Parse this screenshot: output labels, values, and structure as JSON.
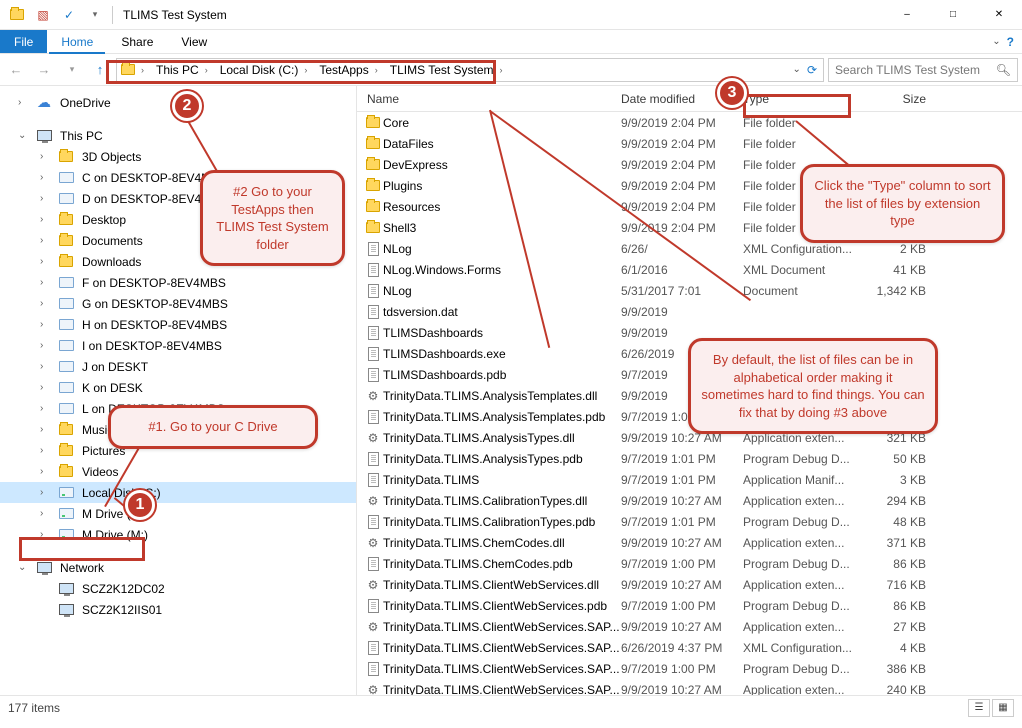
{
  "window": {
    "title": "TLIMS Test System"
  },
  "ribbon": {
    "file": "File",
    "tabs": [
      "Home",
      "Share",
      "View"
    ]
  },
  "breadcrumb": [
    "This PC",
    "Local Disk (C:)",
    "TestApps",
    "TLIMS Test System"
  ],
  "search": {
    "placeholder": "Search TLIMS Test System"
  },
  "columns": {
    "name": "Name",
    "date": "Date modified",
    "type": "Type",
    "size": "Size"
  },
  "tree": {
    "onedrive": "OneDrive",
    "thispc": "This PC",
    "pcitems": [
      "3D Objects",
      "C on DESKTOP-8EV4MBS",
      "D on DESKTOP-8EV4MBS",
      "Desktop",
      "Documents",
      "Downloads",
      "F on DESKTOP-8EV4MBS",
      "G on DESKTOP-8EV4MBS",
      "H on DESKTOP-8EV4MBS",
      "I on DESKTOP-8EV4MBS",
      "J on DESKT",
      "K on DESK",
      "L on DESKTOP-8EV4MBS",
      "Music",
      "Pictures",
      "Videos",
      "Local Disk (C:)",
      "M Drive (M:)",
      "M Drive (M:)"
    ],
    "network": "Network",
    "netitems": [
      "SCZ2K12DC02",
      "SCZ2K12IIS01"
    ]
  },
  "files": [
    {
      "icon": "folder",
      "name": "Core",
      "date": "9/9/2019 2:04 PM",
      "type": "File folder",
      "size": ""
    },
    {
      "icon": "folder",
      "name": "DataFiles",
      "date": "9/9/2019 2:04 PM",
      "type": "File folder",
      "size": ""
    },
    {
      "icon": "folder",
      "name": "DevExpress",
      "date": "9/9/2019 2:04 PM",
      "type": "File folder",
      "size": ""
    },
    {
      "icon": "folder",
      "name": "Plugins",
      "date": "9/9/2019 2:04 PM",
      "type": "File folder",
      "size": ""
    },
    {
      "icon": "folder",
      "name": "Resources",
      "date": "9/9/2019 2:04 PM",
      "type": "File folder",
      "size": ""
    },
    {
      "icon": "folder",
      "name": "Shell3",
      "date": "9/9/2019 2:04 PM",
      "type": "File folder",
      "size": ""
    },
    {
      "icon": "file",
      "name": "NLog",
      "date": "6/26/",
      "type": "XML Configuration...",
      "size": "2 KB"
    },
    {
      "icon": "file",
      "name": "NLog.Windows.Forms",
      "date": "6/1/2016 ",
      "type": "XML Document",
      "size": "41 KB"
    },
    {
      "icon": "file",
      "name": "NLog",
      "date": "5/31/2017 7:01",
      "type": "Document",
      "size": "1,342 KB"
    },
    {
      "icon": "file",
      "name": "tdsversion.dat",
      "date": "9/9/2019",
      "type": "",
      "size": ""
    },
    {
      "icon": "file",
      "name": "TLIMSDashboards",
      "date": "9/9/2019",
      "type": "",
      "size": ""
    },
    {
      "icon": "file",
      "name": "TLIMSDashboards.exe",
      "date": "6/26/2019",
      "type": "",
      "size": ""
    },
    {
      "icon": "file",
      "name": "TLIMSDashboards.pdb",
      "date": "9/7/2019",
      "type": "",
      "size": ""
    },
    {
      "icon": "gear",
      "name": "TrinityData.TLIMS.AnalysisTemplates.dll",
      "date": "9/9/2019",
      "type": "",
      "size": ""
    },
    {
      "icon": "file",
      "name": "TrinityData.TLIMS.AnalysisTemplates.pdb",
      "date": "9/7/2019 1:01 PM",
      "type": "",
      "size": "B"
    },
    {
      "icon": "gear",
      "name": "TrinityData.TLIMS.AnalysisTypes.dll",
      "date": "9/9/2019 10:27 AM",
      "type": "Application exten...",
      "size": "321 KB"
    },
    {
      "icon": "file",
      "name": "TrinityData.TLIMS.AnalysisTypes.pdb",
      "date": "9/7/2019 1:01 PM",
      "type": "Program Debug D...",
      "size": "50 KB"
    },
    {
      "icon": "file",
      "name": "TrinityData.TLIMS",
      "date": "9/7/2019 1:01 PM",
      "type": "Application Manif...",
      "size": "3 KB"
    },
    {
      "icon": "gear",
      "name": "TrinityData.TLIMS.CalibrationTypes.dll",
      "date": "9/9/2019 10:27 AM",
      "type": "Application exten...",
      "size": "294 KB"
    },
    {
      "icon": "file",
      "name": "TrinityData.TLIMS.CalibrationTypes.pdb",
      "date": "9/7/2019 1:01 PM",
      "type": "Program Debug D...",
      "size": "48 KB"
    },
    {
      "icon": "gear",
      "name": "TrinityData.TLIMS.ChemCodes.dll",
      "date": "9/9/2019 10:27 AM",
      "type": "Application exten...",
      "size": "371 KB"
    },
    {
      "icon": "file",
      "name": "TrinityData.TLIMS.ChemCodes.pdb",
      "date": "9/7/2019 1:00 PM",
      "type": "Program Debug D...",
      "size": "86 KB"
    },
    {
      "icon": "gear",
      "name": "TrinityData.TLIMS.ClientWebServices.dll",
      "date": "9/9/2019 10:27 AM",
      "type": "Application exten...",
      "size": "716 KB"
    },
    {
      "icon": "file",
      "name": "TrinityData.TLIMS.ClientWebServices.pdb",
      "date": "9/7/2019 1:00 PM",
      "type": "Program Debug D...",
      "size": "86 KB"
    },
    {
      "icon": "gear",
      "name": "TrinityData.TLIMS.ClientWebServices.SAP...",
      "date": "9/9/2019 10:27 AM",
      "type": "Application exten...",
      "size": "27 KB"
    },
    {
      "icon": "file",
      "name": "TrinityData.TLIMS.ClientWebServices.SAP...",
      "date": "6/26/2019 4:37 PM",
      "type": "XML Configuration...",
      "size": "4 KB"
    },
    {
      "icon": "file",
      "name": "TrinityData.TLIMS.ClientWebServices.SAP...",
      "date": "9/7/2019 1:00 PM",
      "type": "Program Debug D...",
      "size": "386 KB"
    },
    {
      "icon": "gear",
      "name": "TrinityData.TLIMS.ClientWebServices.SAP...",
      "date": "9/9/2019 10:27 AM",
      "type": "Application exten...",
      "size": "240 KB"
    }
  ],
  "status": {
    "text": "177 items"
  },
  "annotations": {
    "badge1": "1",
    "badge2": "2",
    "badge3": "3",
    "callout1": "#1. Go to your C Drive",
    "callout2": "#2 Go to your TestApps then TLIMS Test System folder",
    "callout3": "Click the \"Type\" column to sort the list of files by extension type",
    "callout4": "By default, the list of files can be in alphabetical order making it sometimes hard to find things.  You can fix that by doing #3 above"
  }
}
